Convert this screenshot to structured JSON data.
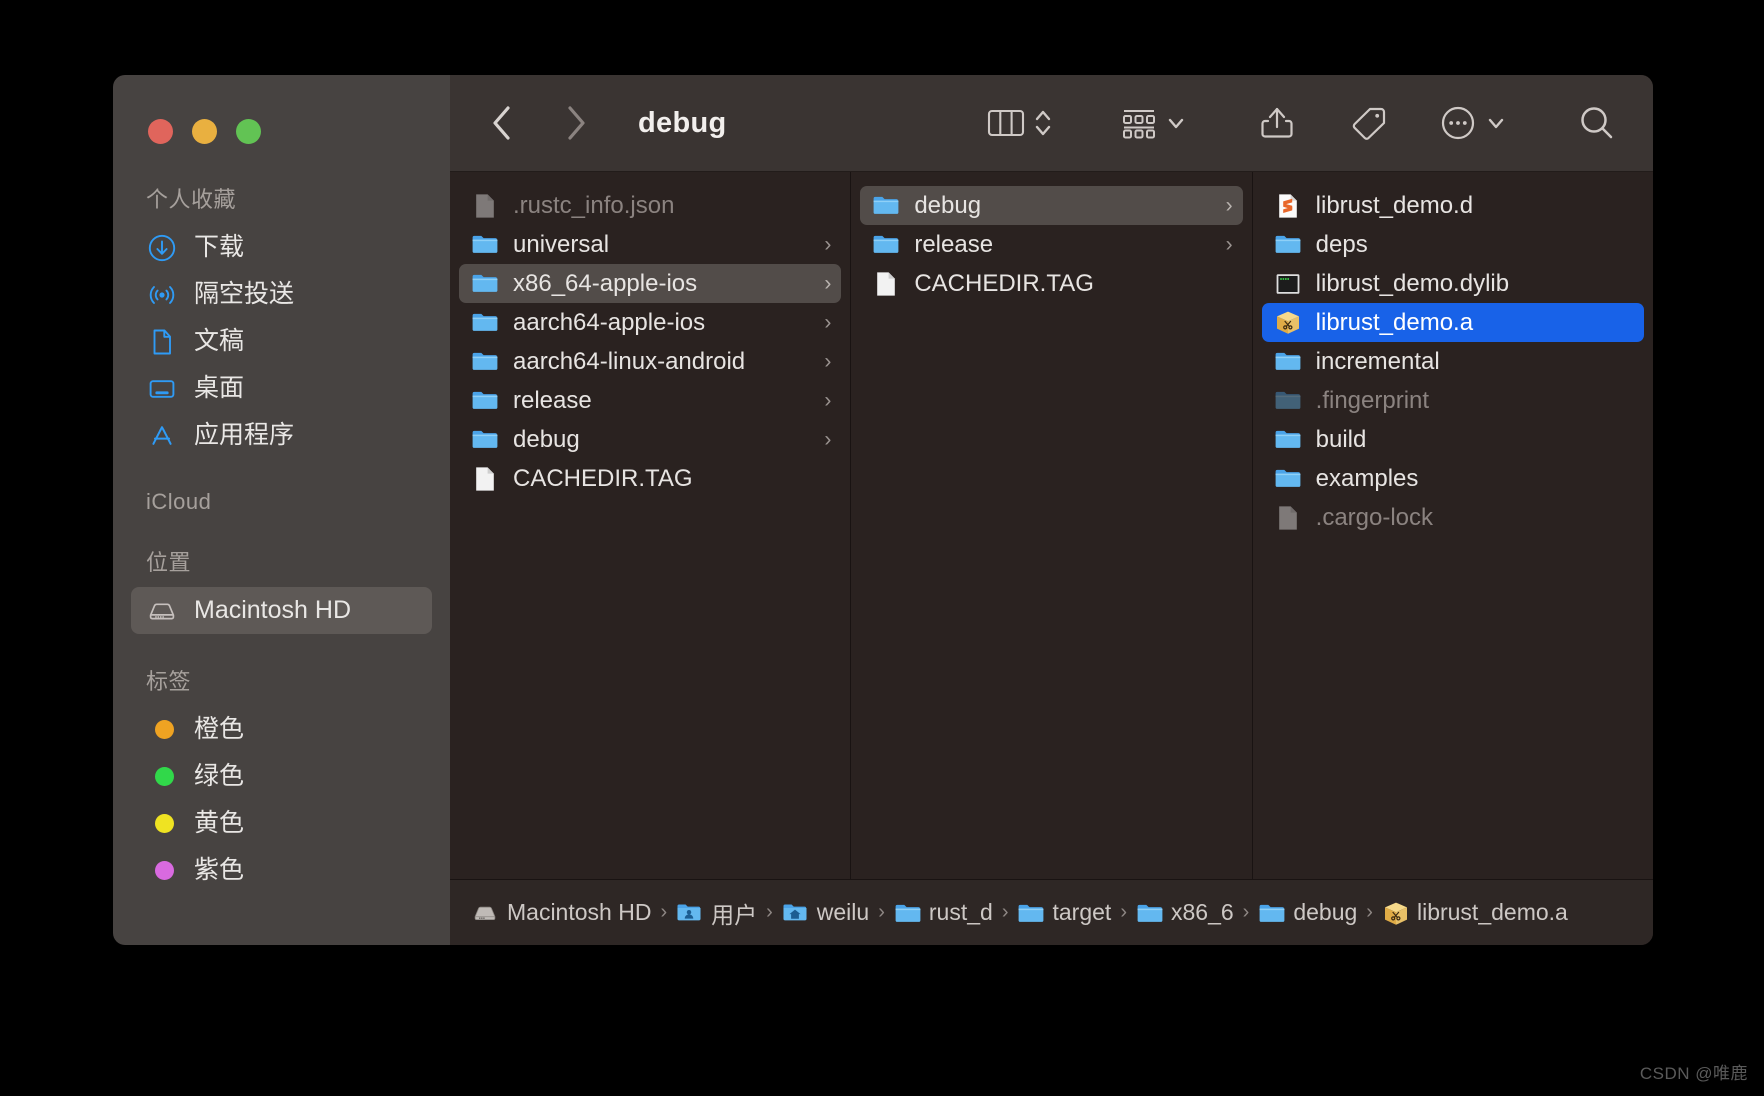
{
  "window": {
    "title": "debug",
    "traffic_lights": [
      "close",
      "minimize",
      "zoom"
    ],
    "accent_blue": "#1862e8",
    "sidebar_bg": "#474341",
    "content_bg": "#2a2220"
  },
  "toolbar": {
    "back_icon": "chevron-left-icon",
    "forward_icon": "chevron-right-icon",
    "view_icon": "column-view-icon",
    "view_stepper_icon": "up-down-chevron-icon",
    "group_icon": "group-by-icon",
    "group_chevron_icon": "chevron-down-icon",
    "share_icon": "share-icon",
    "tag_icon": "tag-icon",
    "more_icon": "ellipsis-circle-icon",
    "more_chevron_icon": "chevron-down-icon",
    "search_icon": "search-icon"
  },
  "sidebar": {
    "sections": [
      {
        "header": "个人收藏",
        "items": [
          {
            "label": "下载",
            "icon": "downloads-icon",
            "selected": false
          },
          {
            "label": "隔空投送",
            "icon": "airdrop-icon",
            "selected": false
          },
          {
            "label": "文稿",
            "icon": "documents-icon",
            "selected": false
          },
          {
            "label": "桌面",
            "icon": "desktop-icon",
            "selected": false
          },
          {
            "label": "应用程序",
            "icon": "applications-icon",
            "selected": false
          }
        ]
      },
      {
        "header": "iCloud",
        "items": []
      },
      {
        "header": "位置",
        "items": [
          {
            "label": "Macintosh HD",
            "icon": "harddisk-icon",
            "selected": true
          }
        ]
      },
      {
        "header": "标签",
        "items": [
          {
            "label": "橙色",
            "icon": "tag-dot",
            "color": "#efa322",
            "selected": false
          },
          {
            "label": "绿色",
            "icon": "tag-dot",
            "color": "#31d84a",
            "selected": false
          },
          {
            "label": "黄色",
            "icon": "tag-dot",
            "color": "#efe322",
            "selected": false
          },
          {
            "label": "紫色",
            "icon": "tag-dot",
            "color": "#d96ae0",
            "selected": false
          }
        ]
      }
    ]
  },
  "columns": [
    {
      "name": "column-1",
      "rows": [
        {
          "name": ".rustc_info.json",
          "icon": "file-icon",
          "dimmed": true,
          "chevron": false,
          "selection": "none"
        },
        {
          "name": "universal",
          "icon": "folder-icon",
          "dimmed": false,
          "chevron": true,
          "selection": "none"
        },
        {
          "name": "x86_64-apple-ios",
          "icon": "folder-icon",
          "dimmed": false,
          "chevron": true,
          "selection": "gray"
        },
        {
          "name": "aarch64-apple-ios",
          "icon": "folder-icon",
          "dimmed": false,
          "chevron": true,
          "selection": "none"
        },
        {
          "name": "aarch64-linux-android",
          "icon": "folder-icon",
          "dimmed": false,
          "chevron": true,
          "selection": "none"
        },
        {
          "name": "release",
          "icon": "folder-icon",
          "dimmed": false,
          "chevron": true,
          "selection": "none"
        },
        {
          "name": "debug",
          "icon": "folder-icon",
          "dimmed": false,
          "chevron": true,
          "selection": "none"
        },
        {
          "name": "CACHEDIR.TAG",
          "icon": "file-icon",
          "dimmed": false,
          "chevron": false,
          "selection": "none"
        }
      ]
    },
    {
      "name": "column-2",
      "rows": [
        {
          "name": "debug",
          "icon": "folder-icon",
          "dimmed": false,
          "chevron": true,
          "selection": "gray"
        },
        {
          "name": "release",
          "icon": "folder-icon",
          "dimmed": false,
          "chevron": true,
          "selection": "none"
        },
        {
          "name": "CACHEDIR.TAG",
          "icon": "file-icon",
          "dimmed": false,
          "chevron": false,
          "selection": "none"
        }
      ]
    },
    {
      "name": "column-3",
      "rows": [
        {
          "name": "librust_demo.d",
          "icon": "sublime-file-icon",
          "dimmed": false,
          "chevron": false,
          "selection": "none"
        },
        {
          "name": "deps",
          "icon": "folder-icon",
          "dimmed": false,
          "chevron": false,
          "selection": "none"
        },
        {
          "name": "librust_demo.dylib",
          "icon": "terminal-file-icon",
          "dimmed": false,
          "chevron": false,
          "selection": "none"
        },
        {
          "name": "librust_demo.a",
          "icon": "archive-box-icon",
          "dimmed": false,
          "chevron": false,
          "selection": "blue"
        },
        {
          "name": "incremental",
          "icon": "folder-icon",
          "dimmed": false,
          "chevron": false,
          "selection": "none"
        },
        {
          "name": ".fingerprint",
          "icon": "folder-icon",
          "dimmed": true,
          "chevron": false,
          "selection": "none"
        },
        {
          "name": "build",
          "icon": "folder-icon",
          "dimmed": false,
          "chevron": false,
          "selection": "none"
        },
        {
          "name": "examples",
          "icon": "folder-icon",
          "dimmed": false,
          "chevron": false,
          "selection": "none"
        },
        {
          "name": ".cargo-lock",
          "icon": "file-icon",
          "dimmed": true,
          "chevron": false,
          "selection": "none"
        }
      ]
    }
  ],
  "pathbar": {
    "items": [
      {
        "label": "Macintosh HD",
        "icon": "harddisk-icon",
        "clipped": false
      },
      {
        "label": "用户",
        "icon": "users-folder-icon",
        "clipped": false
      },
      {
        "label": "weilu",
        "icon": "home-folder-icon",
        "clipped": false
      },
      {
        "label": "rust_d",
        "icon": "folder-icon",
        "clipped": true
      },
      {
        "label": "target",
        "icon": "folder-icon",
        "clipped": false
      },
      {
        "label": "x86_6",
        "icon": "folder-icon",
        "clipped": true
      },
      {
        "label": "debug",
        "icon": "folder-icon",
        "clipped": false
      },
      {
        "label": "librust_demo.a",
        "icon": "archive-box-icon",
        "clipped": false
      }
    ],
    "separator": "›"
  },
  "watermark": {
    "text": "CSDN @唯鹿"
  }
}
